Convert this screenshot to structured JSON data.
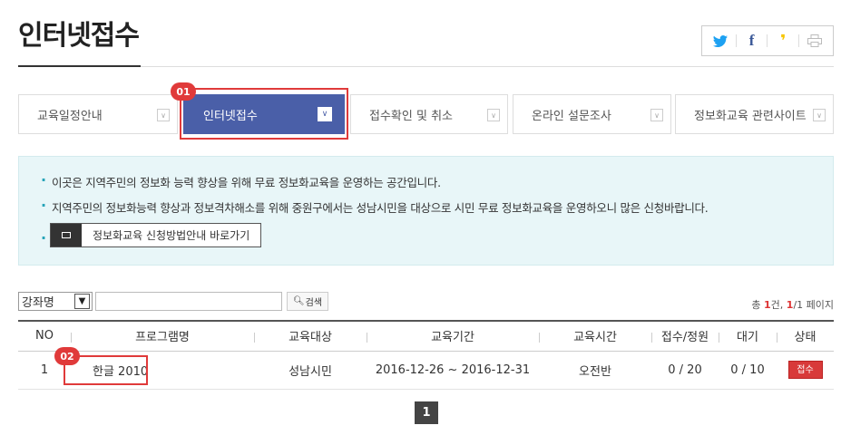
{
  "page": {
    "title": "인터넷접수"
  },
  "share": {
    "twitter": "t",
    "facebook": "f",
    "kakao": "❜",
    "print": "⎙"
  },
  "tabs": [
    {
      "label": "교육일정안내"
    },
    {
      "label": "인터넷접수"
    },
    {
      "label": "접수확인 및 취소"
    },
    {
      "label": "온라인 설문조사"
    },
    {
      "label": "정보화교육 관련사이트"
    }
  ],
  "badges": {
    "step1": "01",
    "step2": "02"
  },
  "notice": {
    "line1": "이곳은 지역주민의 정보화 능력 향상을 위해 무료 정보화교육을 운영하는 공간입니다.",
    "line2": "지역주민의 정보화능력 향상과 정보격차해소를 위해 중원구에서는 성남시민을 대상으로 시민 무료 정보화교육을 운영하오니 많은 신청바랍니다.",
    "guide_button": "정보화교육 신청방법안내 바로가기"
  },
  "search": {
    "select_value": "강좌명",
    "input_value": "",
    "button_label": "검색"
  },
  "count": {
    "prefix": "총 ",
    "total": "1",
    "mid": "건, ",
    "page": "1",
    "suffix": "/1 페이지"
  },
  "table": {
    "headers": [
      "NO",
      "프로그램명",
      "교육대상",
      "교육기간",
      "교육시간",
      "접수/정원",
      "대기",
      "상태"
    ],
    "rows": [
      {
        "no": "1",
        "program": "한글 2010",
        "target": "성남시민",
        "period": "2016-12-26 ~ 2016-12-31",
        "time": "오전반",
        "quota": "0 / 20",
        "wait": "0 / 10",
        "status": "접수"
      }
    ]
  },
  "pagination": {
    "current": "1"
  },
  "colors": {
    "active_tab": "#4a5fa8",
    "highlight": "#e03a3a",
    "notice_bg": "#e8f6f8",
    "status": "#d83a3a",
    "twitter": "#1da1f2",
    "facebook": "#3b5998",
    "kakao": "#f7c600"
  }
}
